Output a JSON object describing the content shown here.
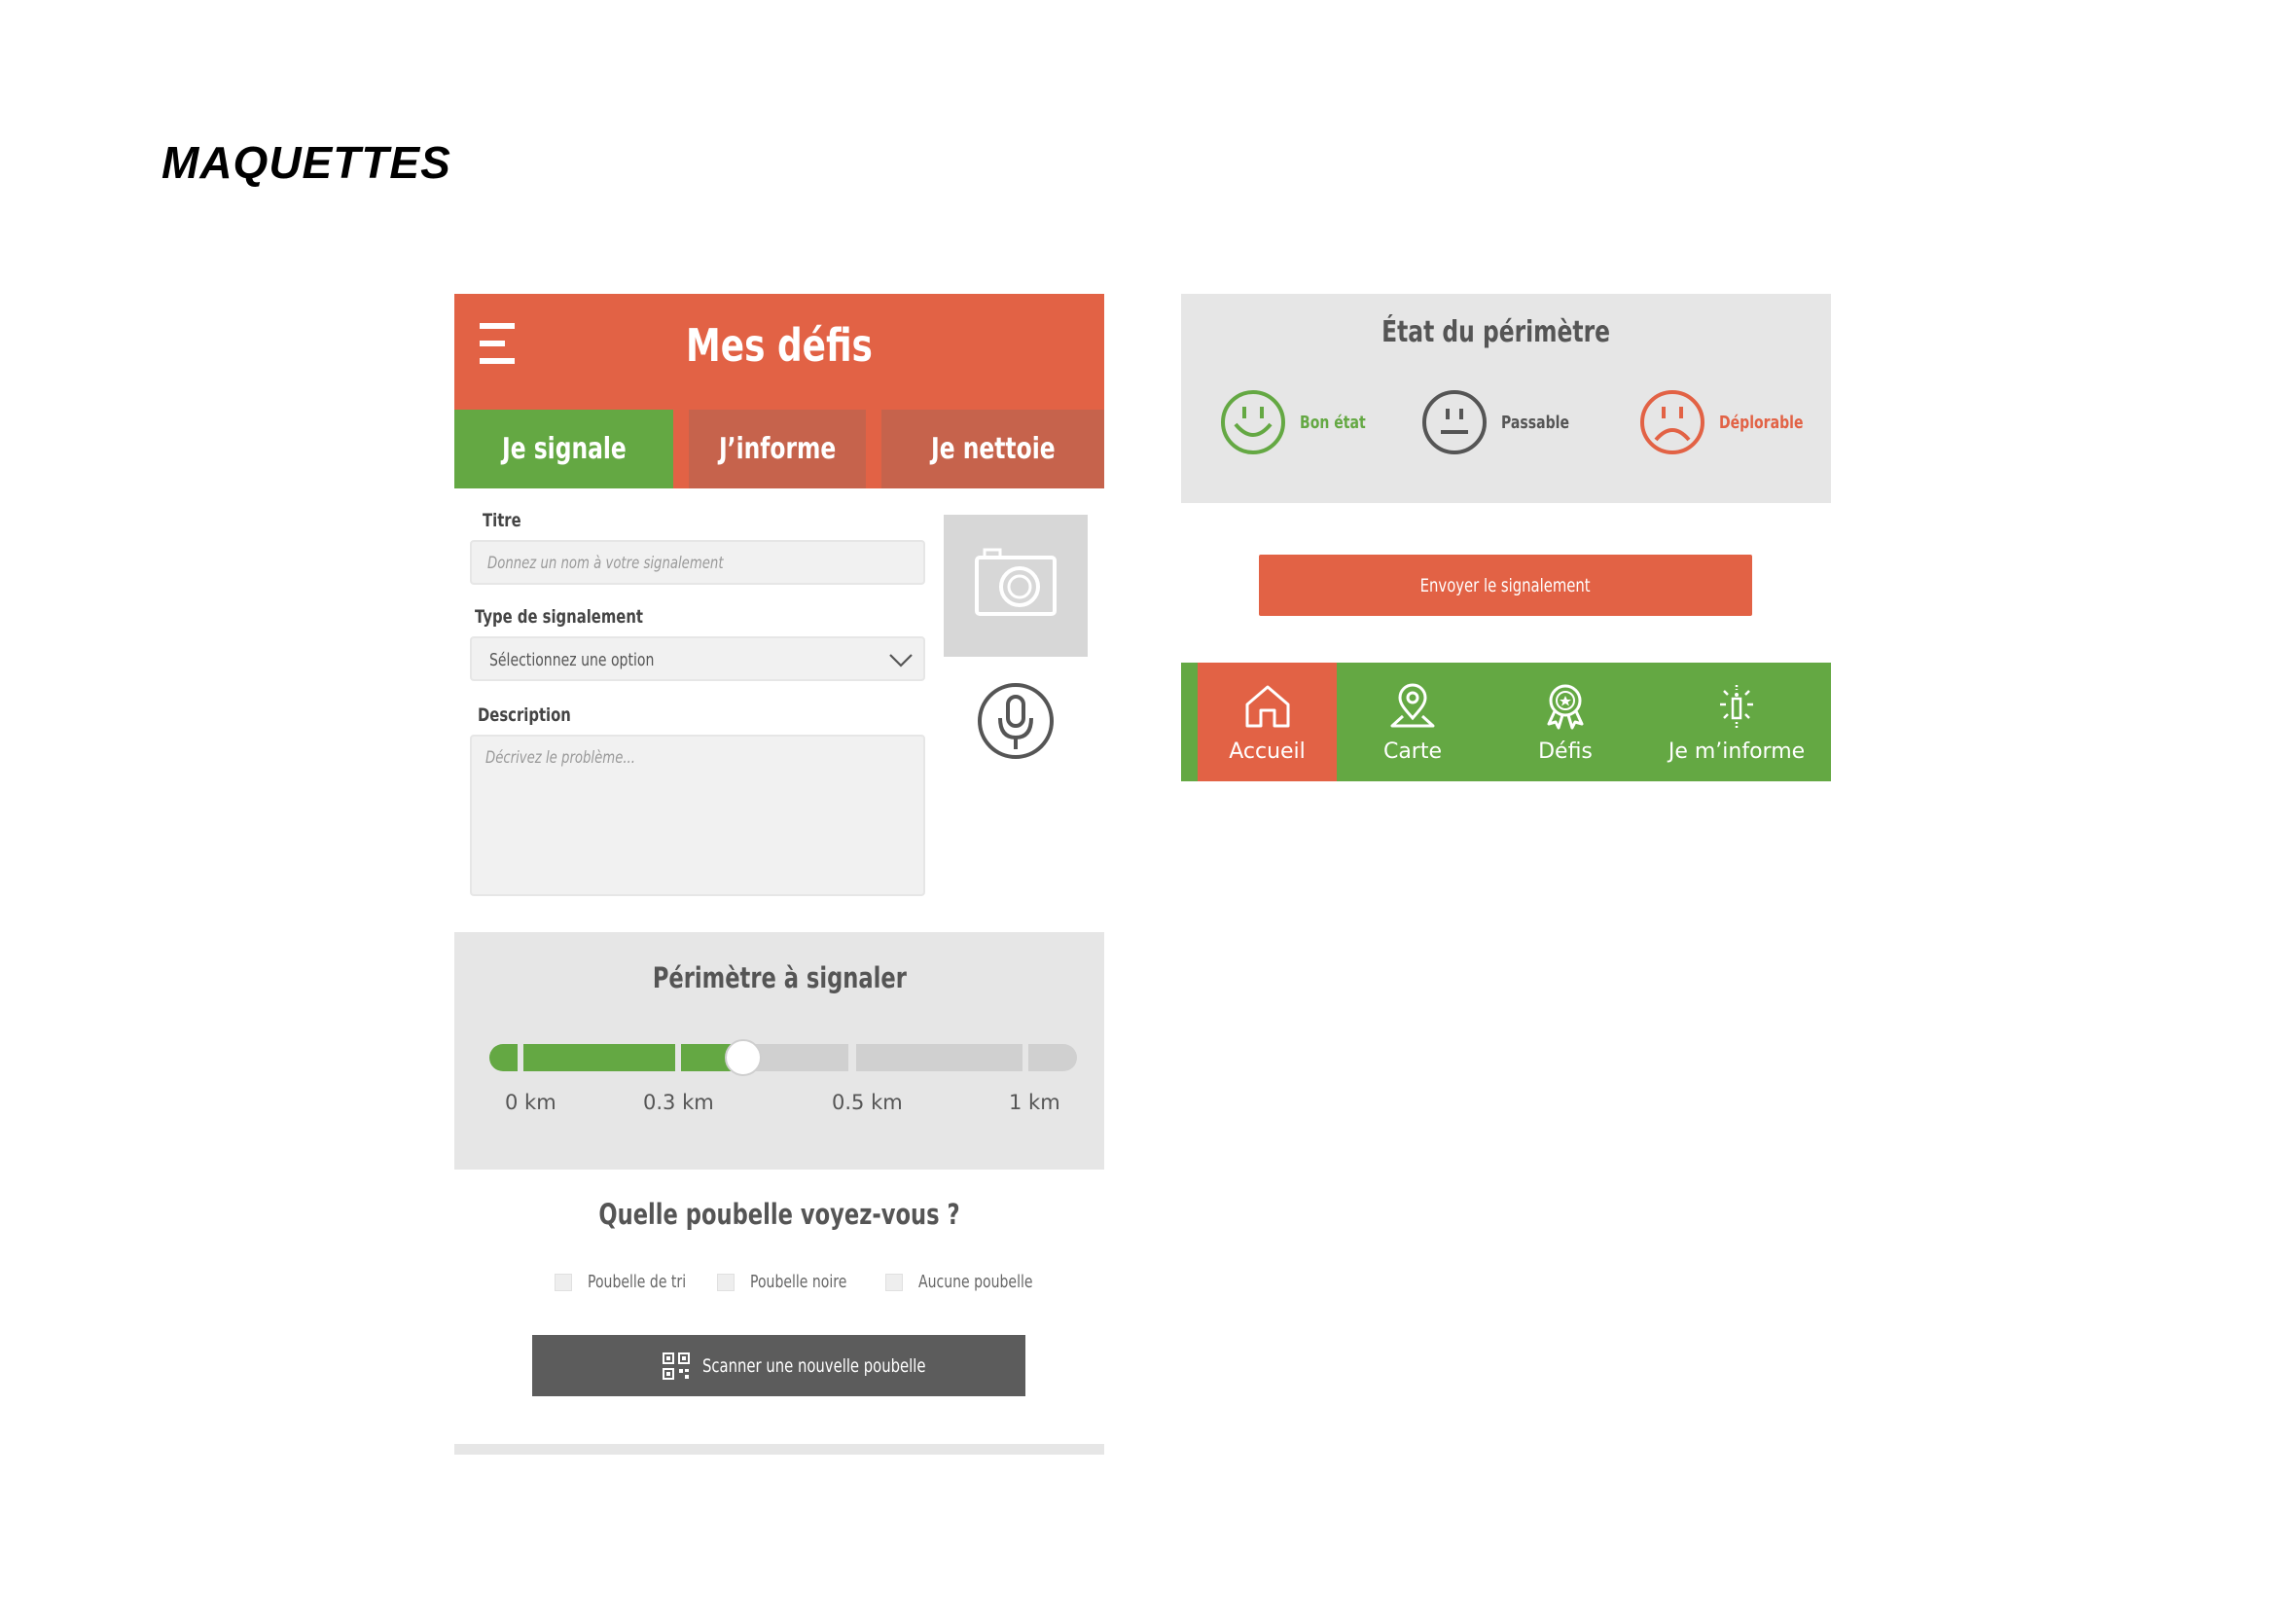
{
  "document": {
    "title": "MAQUETTES"
  },
  "app": {
    "header_title": "Mes défis",
    "tabs": [
      {
        "label": "Je signale",
        "active": true
      },
      {
        "label": "J’informe",
        "active": false
      },
      {
        "label": "Je nettoie",
        "active": false
      }
    ]
  },
  "form": {
    "title_label": "Titre",
    "title_placeholder": "Donnez un nom à votre signalement",
    "type_label": "Type de signalement",
    "type_selected": "Sélectionnez une option",
    "description_label": "Description",
    "description_placeholder": "Décrivez le problème..."
  },
  "perimeter": {
    "title": "Périmètre à signaler",
    "ticks": [
      "0 km",
      "0.3 km",
      "0.5 km",
      "1 km"
    ],
    "selected_km": 0.35
  },
  "bins": {
    "question": "Quelle poubelle voyez-vous ?",
    "options": [
      "Poubelle de tri",
      "Poubelle noire",
      "Aucune poubelle"
    ],
    "scan_label": "Scanner une nouvelle poubelle"
  },
  "state": {
    "title": "État du périmètre",
    "options": [
      {
        "label": "Bon état",
        "color": "#64a843",
        "icon": "happy-face-icon"
      },
      {
        "label": "Passable",
        "color": "#555555",
        "icon": "neutral-face-icon"
      },
      {
        "label": "Déplorable",
        "color": "#e26245",
        "icon": "sad-face-icon"
      }
    ]
  },
  "send_button": "Envoyer le signalement",
  "nav": {
    "items": [
      {
        "label": "Accueil",
        "icon": "home-icon",
        "active": true
      },
      {
        "label": "Carte",
        "icon": "map-pin-icon",
        "active": false
      },
      {
        "label": "Défis",
        "icon": "badge-icon",
        "active": false
      },
      {
        "label": "Je m’informe",
        "icon": "lightbulb-icon",
        "active": false
      }
    ]
  },
  "colors": {
    "primary": "#e26245",
    "green": "#64a843",
    "tab_inactive": "#c6634c",
    "panel": "#e6e6e6",
    "dark_button": "#5c5c5c"
  }
}
